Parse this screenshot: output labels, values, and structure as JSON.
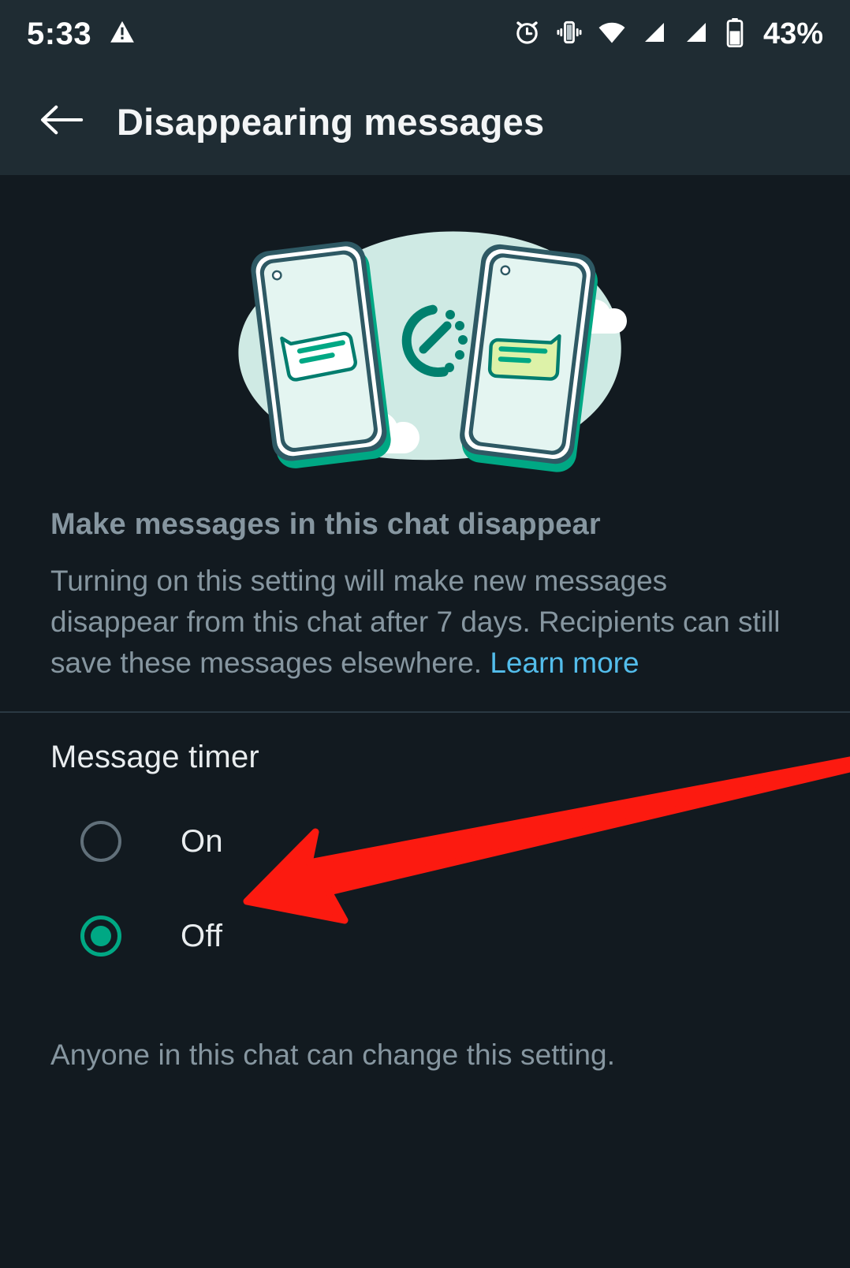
{
  "status_bar": {
    "time": "5:33",
    "battery_percent": "43%",
    "icons": [
      "warning-triangle-icon",
      "alarm-clock-icon",
      "vibrate-icon",
      "wifi-icon",
      "signal-bars-sim1-icon",
      "signal-bars-sim2-icon",
      "battery-icon"
    ]
  },
  "app_bar": {
    "back_label": "back-arrow",
    "title": "Disappearing messages"
  },
  "hero": {
    "illustration_name": "two-phones-with-timer-illustration",
    "colors": {
      "blob": "#cfeae4",
      "phone_screen": "#e4f5f1",
      "phone_outline": "#2e5964",
      "phone_base_shadow": "#00a884",
      "bubble_outline": "#007d6e",
      "bubble_incoming_fill": "#ffffff",
      "bubble_outgoing_fill": "#ddf2a8",
      "timer": "#00806e",
      "cloud": "#ffffff"
    }
  },
  "info": {
    "heading": "Make messages in this chat disappear",
    "body_before_link": "Turning on this setting will make new messages disappear from this chat after 7 days. Recipients can still save these messages elsewhere. ",
    "link_label": "Learn more"
  },
  "message_timer": {
    "section_title": "Message timer",
    "options": [
      {
        "label": "On",
        "selected": false
      },
      {
        "label": "Off",
        "selected": true
      }
    ],
    "footnote": "Anyone in this chat can change this setting."
  },
  "annotation": {
    "arrow_name": "red-pointer-arrow",
    "color": "#fc1a10",
    "points_at": "On"
  },
  "colors": {
    "app_bar_background": "#1f2c33",
    "page_background": "#121a20",
    "accent_green": "#00a884",
    "link_blue": "#53bdeb",
    "secondary_text": "#8696a0",
    "primary_text": "#e9edef",
    "divider": "#2a3942"
  }
}
